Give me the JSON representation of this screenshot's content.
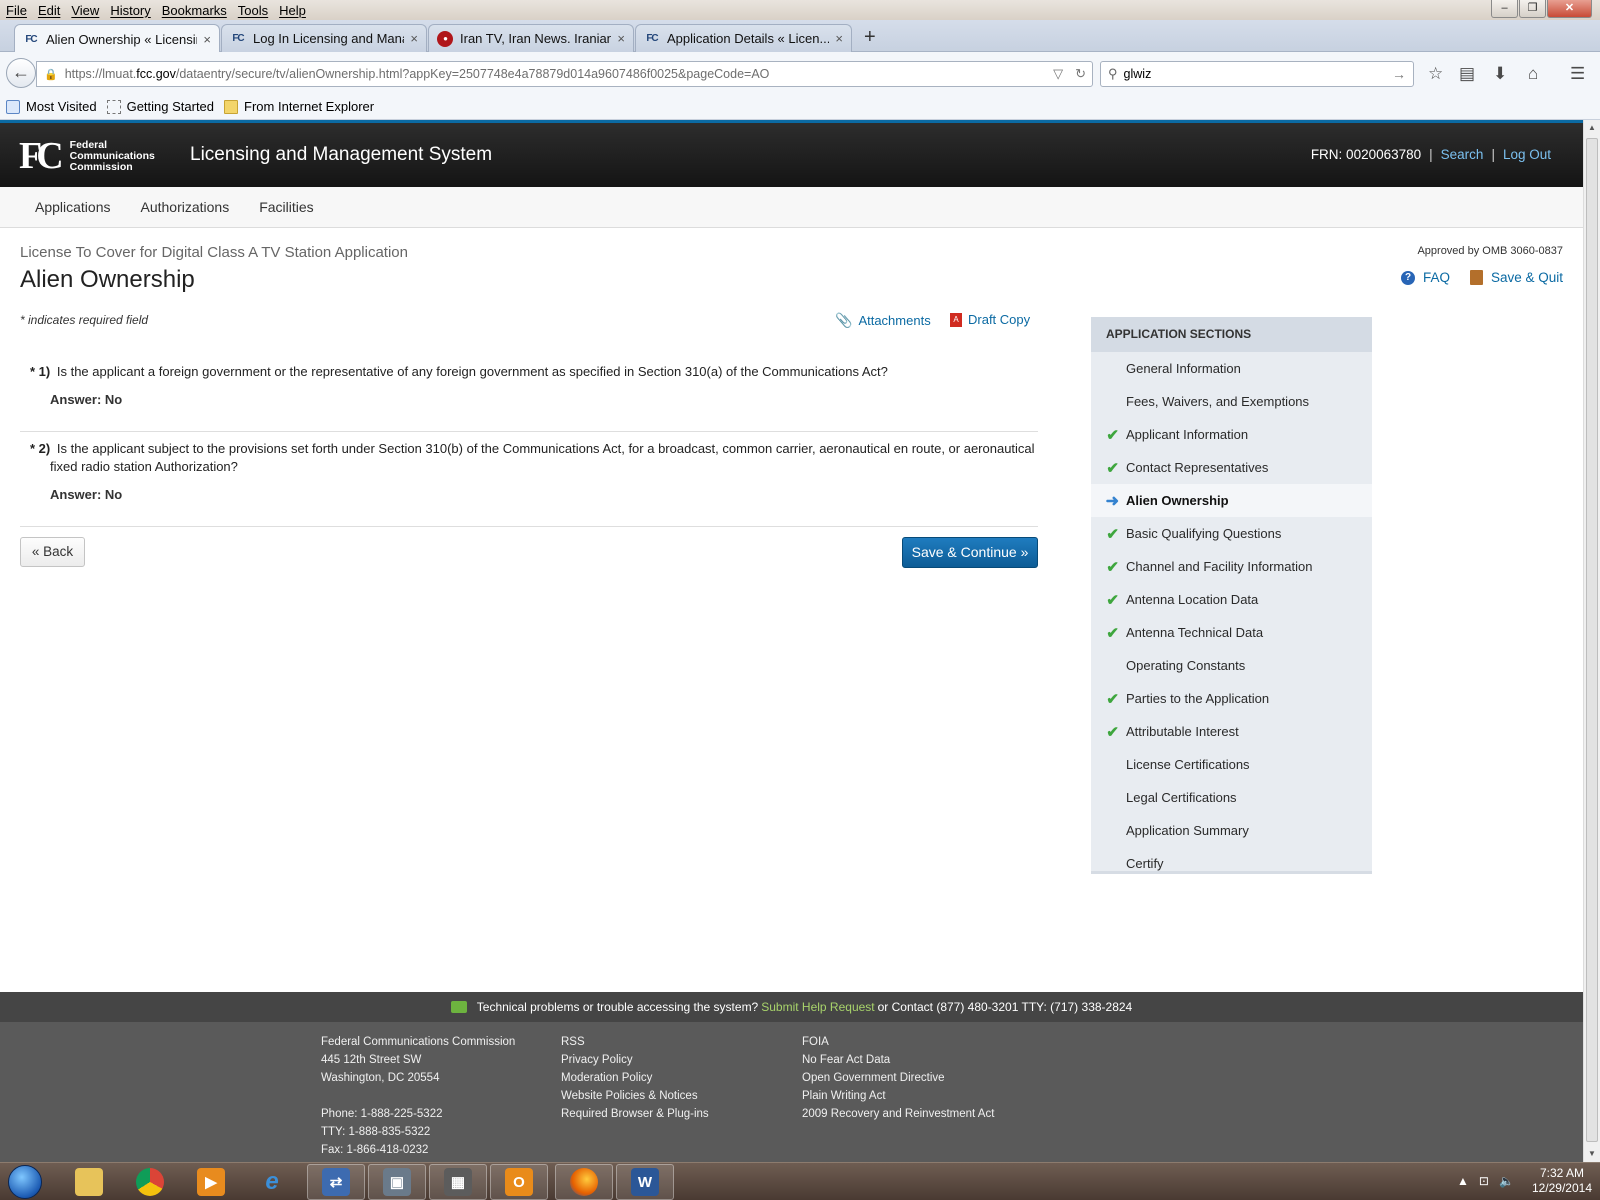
{
  "browser": {
    "menu": [
      "File",
      "Edit",
      "View",
      "History",
      "Bookmarks",
      "Tools",
      "Help"
    ],
    "window_controls": {
      "minimize": "–",
      "maximize": "❐",
      "close": "✕"
    },
    "tabs": [
      {
        "title": "Alien Ownership « Licensin...",
        "icon": "fcc-favicon",
        "active": true
      },
      {
        "title": "Log In Licensing and Mana...",
        "icon": "fcc-favicon",
        "active": false
      },
      {
        "title": "Iran TV, Iran News. Iranian ...",
        "icon": "iran-tv-favicon",
        "active": false
      },
      {
        "title": "Application Details « Licen...",
        "icon": "fcc-favicon",
        "active": false
      }
    ],
    "new_tab": "+",
    "tab_close": "×",
    "url_prefix": "https://lmuat.",
    "url_domain": "fcc.gov",
    "url_suffix": "/dataentry/secure/tv/alienOwnership.html?appKey=2507748e4a78879d014a9607486f0025&pageCode=AO",
    "search_value": "glwiz",
    "bookmarks": [
      "Most Visited",
      "Getting Started",
      "From Internet Explorer"
    ]
  },
  "site": {
    "logo_mark": "FC",
    "agency_lines": [
      "Federal",
      "Communications",
      "Commission"
    ],
    "system_name": "Licensing and Management System",
    "frn_label": "FRN: 0020063780",
    "search_link": "Search",
    "logout_link": "Log Out",
    "separator": "|",
    "nav": [
      "Applications",
      "Authorizations",
      "Facilities"
    ]
  },
  "page": {
    "app_title": "License To Cover for Digital Class A TV Station Application",
    "title": "Alien Ownership",
    "omb": "Approved by OMB 3060-0837",
    "faq": "FAQ",
    "save_quit": "Save & Quit",
    "required_note": "* indicates required field",
    "attachments": "Attachments",
    "draft_copy": "Draft Copy",
    "questions": [
      {
        "num": "* 1)",
        "text": "Is the applicant a foreign government or the representative of any foreign government as specified in Section 310(a) of the Communications Act?",
        "answer": "Answer: No"
      },
      {
        "num": "* 2)",
        "text": "Is the applicant subject to the provisions set forth under Section 310(b) of the Communications Act, for a broadcast, common carrier, aeronautical en route, or aeronautical fixed radio station Authorization?",
        "answer": "Answer: No"
      }
    ],
    "back_button": "« Back",
    "save_continue_button": "Save & Continue »"
  },
  "sections": {
    "header": "APPLICATION SECTIONS",
    "items": [
      {
        "label": "General Information",
        "status": "none"
      },
      {
        "label": "Fees, Waivers, and Exemptions",
        "status": "none"
      },
      {
        "label": "Applicant Information",
        "status": "complete"
      },
      {
        "label": "Contact Representatives",
        "status": "complete"
      },
      {
        "label": "Alien Ownership",
        "status": "current"
      },
      {
        "label": "Basic Qualifying Questions",
        "status": "complete"
      },
      {
        "label": "Channel and Facility Information",
        "status": "complete"
      },
      {
        "label": "Antenna Location Data",
        "status": "complete"
      },
      {
        "label": "Antenna Technical Data",
        "status": "complete"
      },
      {
        "label": "Operating Constants",
        "status": "none"
      },
      {
        "label": "Parties to the Application",
        "status": "complete"
      },
      {
        "label": "Attributable Interest",
        "status": "complete"
      },
      {
        "label": "License Certifications",
        "status": "none"
      },
      {
        "label": "Legal Certifications",
        "status": "none"
      },
      {
        "label": "Application Summary",
        "status": "none"
      },
      {
        "label": "Certify",
        "status": "none"
      }
    ]
  },
  "footer": {
    "help_text": "Technical problems or trouble accessing the system?",
    "help_link": "Submit Help Request",
    "help_contact": "or Contact (877) 480-3201 TTY: (717) 338-2824",
    "address": [
      "Federal Communications Commission",
      "445 12th Street SW",
      "Washington, DC 20554",
      "",
      "Phone: 1-888-225-5322",
      "TTY: 1-888-835-5322",
      "Fax: 1-866-418-0232"
    ],
    "links_col2": [
      "RSS",
      "Privacy Policy",
      "Moderation Policy",
      "Website Policies & Notices",
      "Required Browser & Plug-ins"
    ],
    "links_col3": [
      "FOIA",
      "No Fear Act Data",
      "Open Government Directive",
      "Plain Writing Act",
      "2009 Recovery and Reinvestment Act"
    ]
  },
  "taskbar": {
    "apps": [
      "file-explorer",
      "chrome",
      "media-player",
      "internet-explorer",
      "network-app",
      "scanner-app",
      "calculator-app",
      "outlook",
      "firefox",
      "word"
    ],
    "time": "7:32 AM",
    "date": "12/29/2014"
  },
  "colors": {
    "link": "#0b6aa3",
    "primary_button": "#0d5c96",
    "check": "#3ea63e",
    "header_bg": "#1e1e1e"
  }
}
